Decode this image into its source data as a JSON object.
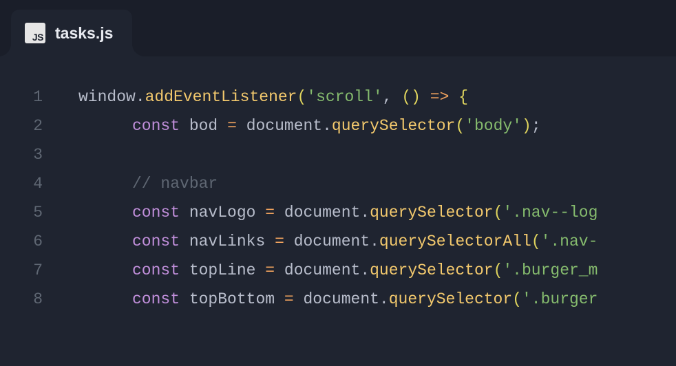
{
  "tab": {
    "icon_text": "JS",
    "filename": "tasks.js"
  },
  "gutter": [
    "1",
    "2",
    "3",
    "4",
    "5",
    "6",
    "7",
    "8"
  ],
  "code": {
    "l1": {
      "obj1": "window",
      "dot1": ".",
      "call1": "addEventListener",
      "p1": "(",
      "str1": "'scroll'",
      "comma1": ",",
      "sp1": " ",
      "p2": "(",
      "p3": ")",
      "sp2": " ",
      "arrow": "=>",
      "sp3": " ",
      "brace": "{"
    },
    "l2": {
      "kw": "const",
      "sp1": " ",
      "var": "bod",
      "sp2": " ",
      "eq": "=",
      "sp3": " ",
      "obj": "document",
      "dot": ".",
      "call": "querySelector",
      "p1": "(",
      "str": "'body'",
      "p2": ")",
      "semi": ";"
    },
    "l4": {
      "cmt": "// navbar"
    },
    "l5": {
      "kw": "const",
      "sp1": " ",
      "var": "navLogo",
      "sp2": " ",
      "eq": "=",
      "sp3": " ",
      "obj": "document",
      "dot": ".",
      "call": "querySelector",
      "p1": "(",
      "str": "'.nav--log"
    },
    "l6": {
      "kw": "const",
      "sp1": " ",
      "var": "navLinks",
      "sp2": " ",
      "eq": "=",
      "sp3": " ",
      "obj": "document",
      "dot": ".",
      "call": "querySelectorAll",
      "p1": "(",
      "str": "'.nav-"
    },
    "l7": {
      "kw": "const",
      "sp1": " ",
      "var": "topLine",
      "sp2": " ",
      "eq": "=",
      "sp3": " ",
      "obj": "document",
      "dot": ".",
      "call": "querySelector",
      "p1": "(",
      "str": "'.burger_m"
    },
    "l8": {
      "kw": "const",
      "sp1": " ",
      "var": "topBottom",
      "sp2": " ",
      "eq": "=",
      "sp3": " ",
      "obj": "document",
      "dot": ".",
      "call": "querySelector",
      "p1": "(",
      "str": "'.burger"
    }
  }
}
